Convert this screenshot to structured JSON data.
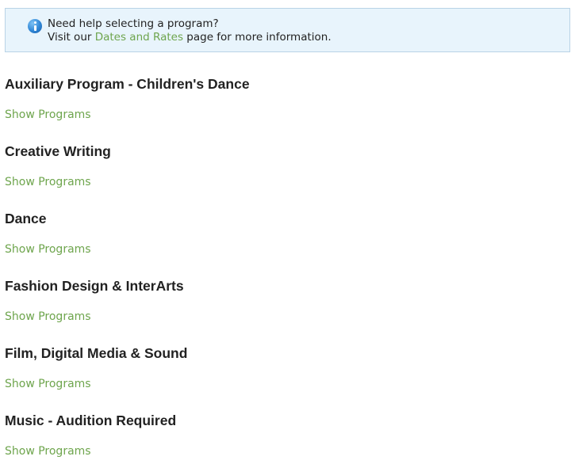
{
  "info": {
    "line1": "Need help selecting a program?",
    "line2_prefix": "Visit our ",
    "line2_link": "Dates and Rates",
    "line2_suffix": " page for more information.",
    "icon": "info-icon"
  },
  "colors": {
    "link": "#6ea54d",
    "info_bg": "#e8f4fc",
    "info_border": "#b9d3e6",
    "heading": "#222222"
  },
  "categories": [
    {
      "title": "Auxiliary Program - Children's Dance",
      "link": "Show Programs"
    },
    {
      "title": "Creative Writing",
      "link": "Show Programs"
    },
    {
      "title": "Dance",
      "link": "Show Programs"
    },
    {
      "title": "Fashion Design & InterArts",
      "link": "Show Programs"
    },
    {
      "title": "Film, Digital Media & Sound",
      "link": "Show Programs"
    },
    {
      "title": "Music - Audition Required",
      "link": "Show Programs"
    }
  ]
}
